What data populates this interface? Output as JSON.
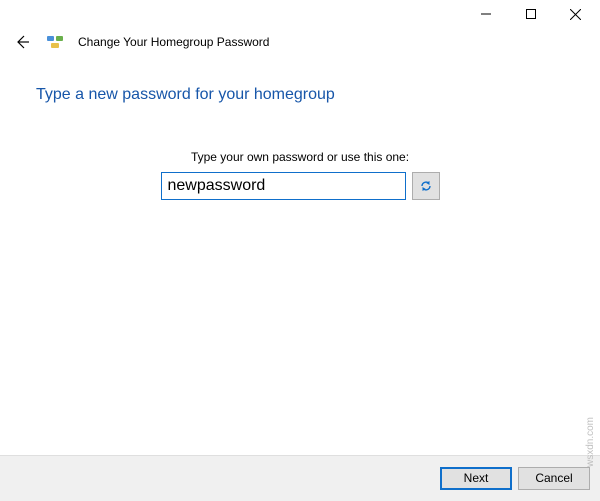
{
  "window": {
    "title": "Change Your Homegroup Password"
  },
  "main": {
    "heading": "Type a new password for your homegroup",
    "instruction": "Type your own password or use this one:",
    "password_value": "newpassword"
  },
  "buttons": {
    "next": "Next",
    "cancel": "Cancel"
  },
  "icons": {
    "back": "back-arrow",
    "homegroup": "homegroup-icon",
    "refresh": "refresh-icon",
    "minimize": "minimize",
    "maximize": "maximize",
    "close": "close"
  },
  "watermark": "wsxdn.com"
}
